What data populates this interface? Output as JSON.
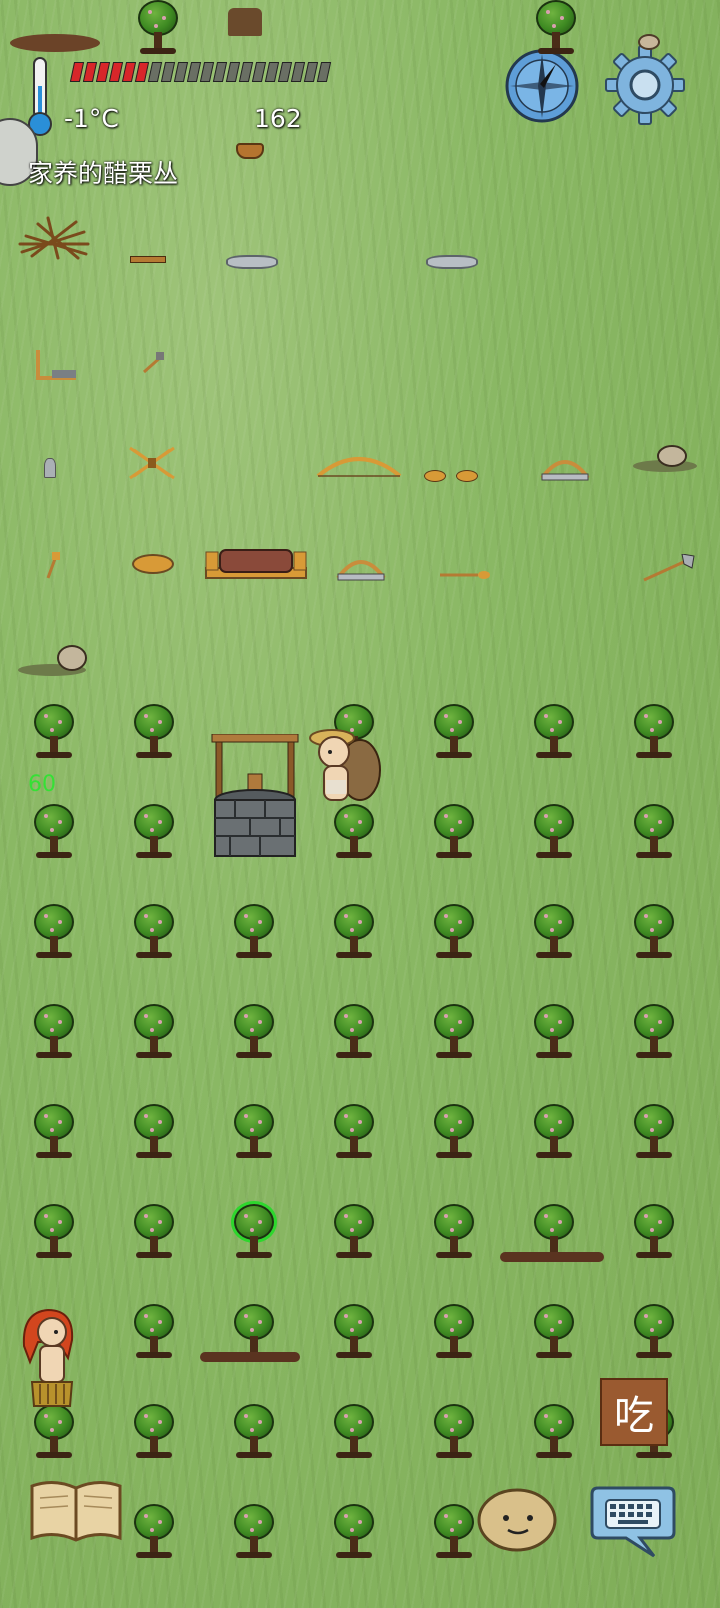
{
  "hud": {
    "temperature": "-1°C",
    "score": "162",
    "object_label": "家养的醋栗丛",
    "food_pips_filled": 6,
    "food_pips_total": 20,
    "food_color": "#d8262a",
    "empty_pip_color": "#6a6f64"
  },
  "field": {
    "age_number": "60",
    "age_color": "#35e035"
  },
  "actions": {
    "eat_label": "吃"
  },
  "icons": {
    "compass": "compass-icon",
    "settings": "gear-icon",
    "thermometer": "thermometer-icon",
    "book": "recipe-book-icon",
    "emote": "emote-face-icon",
    "keyboard": "keyboard-chat-icon"
  }
}
